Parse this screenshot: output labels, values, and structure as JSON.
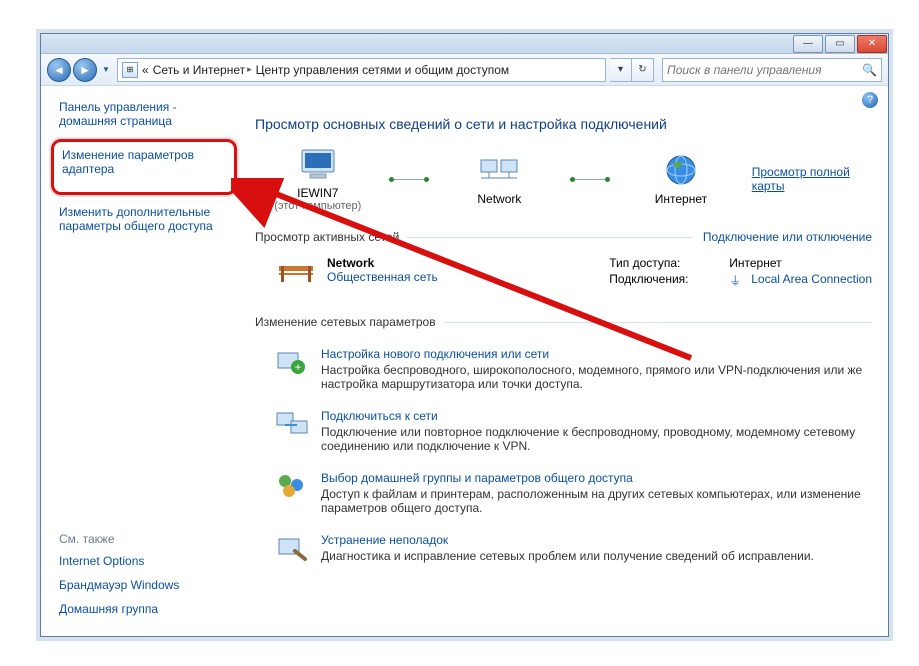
{
  "breadcrumb": {
    "prefix": "«",
    "seg1": "Сеть и Интернет",
    "seg2": "Центр управления сетями и общим доступом"
  },
  "search": {
    "placeholder": "Поиск в панели управления"
  },
  "sidebar": {
    "cp_home": "Панель управления - домашняя страница",
    "adapter": "Изменение параметров адаптера",
    "advanced": "Изменить дополнительные параметры общего доступа",
    "see_also_hd": "См. также",
    "see_also": {
      "internet_options": "Internet Options",
      "firewall": "Брандмауэр Windows",
      "homegroup": "Домашняя группа"
    }
  },
  "content": {
    "title": "Просмотр основных сведений о сети и настройка подключений",
    "map": {
      "node1_name": "IEWIN7",
      "node1_sub": "(этот компьютер)",
      "node2_name": "Network",
      "node3_name": "Интернет",
      "full_map": "Просмотр полной карты"
    },
    "active_hd": "Просмотр активных сетей",
    "active_link": "Подключение или отключение",
    "active": {
      "name": "Network",
      "type": "Общественная сеть",
      "access_lbl": "Тип доступа:",
      "access_val": "Интернет",
      "conn_lbl": "Подключения:",
      "conn_val": "Local Area Connection"
    },
    "params_hd": "Изменение сетевых параметров",
    "items": [
      {
        "title": "Настройка нового подключения или сети",
        "desc": "Настройка беспроводного, широкополосного, модемного, прямого или VPN-подключения или же настройка маршрутизатора или точки доступа."
      },
      {
        "title": "Подключиться к сети",
        "desc": "Подключение или повторное подключение к беспроводному, проводному, модемному сетевому соединению или подключение к VPN."
      },
      {
        "title": "Выбор домашней группы и параметров общего доступа",
        "desc": "Доступ к файлам и принтерам, расположенным на других сетевых компьютерах, или изменение параметров общего доступа."
      },
      {
        "title": "Устранение неполадок",
        "desc": "Диагностика и исправление сетевых проблем или получение сведений об исправлении."
      }
    ]
  }
}
